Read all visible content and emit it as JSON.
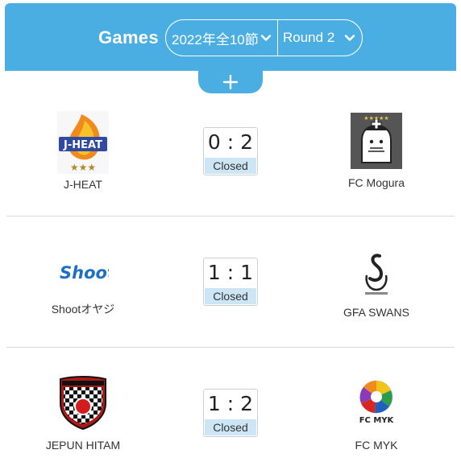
{
  "header": {
    "title": "Games",
    "season_select": "2022年全10節",
    "round_select": "Round 2",
    "accent_color": "#4aaee3"
  },
  "matches": [
    {
      "home": {
        "name": "J-HEAT",
        "logo": "j-heat-logo"
      },
      "away": {
        "name": "FC Mogura",
        "logo": "fc-mogura-logo"
      },
      "score": "0 : 2",
      "status": "Closed"
    },
    {
      "home": {
        "name": "Shootオヤジ",
        "logo": "shoot-logo",
        "logo_text": "Shoot"
      },
      "away": {
        "name": "GFA SWANS",
        "logo": "gfa-swans-logo"
      },
      "score": "1 : 1",
      "status": "Closed"
    },
    {
      "home": {
        "name": "JEPUN HITAM",
        "logo": "jepun-hitam-logo"
      },
      "away": {
        "name": "FC MYK",
        "logo": "fc-myk-logo",
        "logo_text": "FC MYK"
      },
      "score": "1 : 2",
      "status": "Closed"
    }
  ]
}
